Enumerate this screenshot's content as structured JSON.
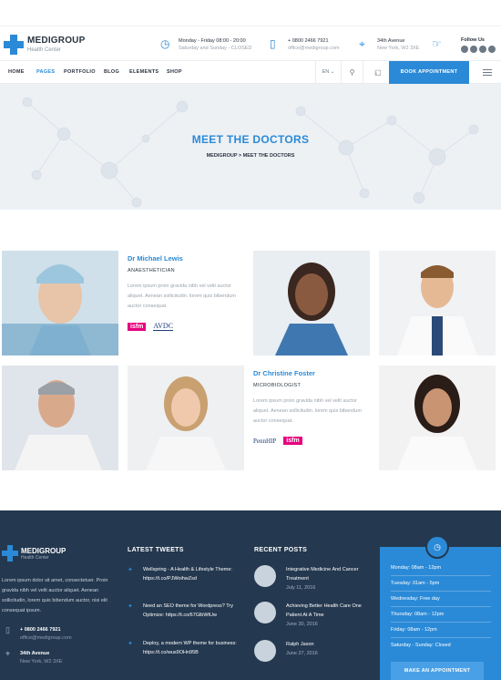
{
  "header": {
    "brand": "MEDIGROUP",
    "tagline": "Health Center",
    "hours_line1": "Monday - Friday 08:00 - 20:00",
    "hours_line2": "Saturday and Sunday - CLOSED",
    "phone": "+ 0800 2466 7921",
    "email": "office@medigroup.com",
    "address_line1": "34th Avenue",
    "address_line2": "New York, W2 3XE",
    "follow_label": "Follow Us"
  },
  "nav": {
    "items": [
      "HOME",
      "PAGES",
      "PORTFOLIO",
      "BLOG",
      "ELEMENTS",
      "SHOP"
    ],
    "lang": "EN",
    "cart_count": "0",
    "book_label": "BOOK APPOINTMENT"
  },
  "hero": {
    "title": "MEET THE DOCTORS",
    "breadcrumb": "MEDIGROUP  >  MEET THE DOCTORS"
  },
  "doctors": [
    {
      "name": "Dr Michael Lewis",
      "role": "ANAESTHETICIAN",
      "desc": "Lorem ipsum proin gravida nibh vel velit auctor aliquet. Aenean sollicitudin. lorem quis bibendum auctor consequat.",
      "badge1": "isfm",
      "badge2": "AVDC"
    },
    {
      "name": "Dr Christine Foster",
      "role": "MICROBIOLOGIST",
      "desc": "Lorem ipsum proin gravida nibh vel velit auctor aliquet. Aenean sollicitudin. lorem quis bibendum auctor consequat.",
      "badge1": "PennHIP",
      "badge2": "isfm"
    }
  ],
  "footer": {
    "brand": "MEDIGROUP",
    "tagline": "Health Center",
    "about": "Lorem ipsum dolor sit amet, consectetuer. Proin gravida nibh vel velit auctor aliquet. Aenean sollicitudin, lorem quis bibendum auctor, nisi elit consequat ipsum.",
    "phone": "+ 0800 2466 7921",
    "email": "office@medigroup.com",
    "address_line1": "34th Avenue",
    "address_line2": "New York, W2 3XE",
    "tweets_heading": "LATEST TWEETS",
    "tweets": [
      "Wellspring - A Health & Lifestyle Theme: https://t.co/PJWoihwZsd",
      "Need an SEO theme for Wordpress? Try Optimize: https://t.co/67GlbWtUw",
      "Deploy, a modern WP theme for business: https://t.co/wus9OHn95B"
    ],
    "posts_heading": "RECENT POSTS",
    "posts": [
      {
        "title": "Integrative Medicine And Cancer Treatment",
        "date": "July 11, 2016"
      },
      {
        "title": "Achieving Better Health Care One Patient At A Time",
        "date": "June 30, 2016"
      },
      {
        "title": "Ralph Jason",
        "date": "June 27, 2016"
      }
    ],
    "hours": [
      "Monday: 08am - 12pm",
      "Tuesday: 01am - 5pm",
      "Wednesday: Free day",
      "Thursday: 08am - 12pm",
      "Friday: 08am - 12pm",
      "Saturday - Sunday: Closed"
    ],
    "appointment_label": "MAKE AN APPOINTMENT"
  },
  "colors": {
    "accent": "#2b8ad7",
    "footer_bg": "#24384f",
    "hero_bg": "#eef1f4"
  }
}
